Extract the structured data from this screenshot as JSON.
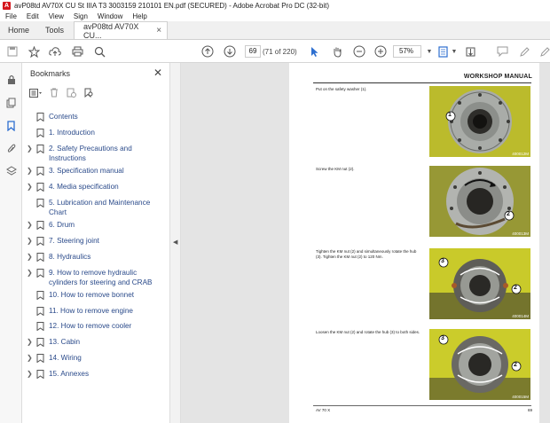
{
  "window": {
    "title": "avP08td AV70X CU St IIIA T3 3003159 210101 EN.pdf (SECURED) - Adobe Acrobat Pro DC (32-bit)"
  },
  "menu": [
    "File",
    "Edit",
    "View",
    "Sign",
    "Window",
    "Help"
  ],
  "tabs": {
    "home": "Home",
    "tools": "Tools",
    "document": "avP08td AV70X CU..."
  },
  "toolbar": {
    "page_number": "69",
    "page_count": "(71 of 220)",
    "zoom": "57%"
  },
  "bookmarks": {
    "title": "Bookmarks",
    "items": [
      {
        "label": "Contents",
        "expandable": false
      },
      {
        "label": "1. Introduction",
        "expandable": false
      },
      {
        "label": "2. Safety Precautions and Instructions",
        "expandable": true
      },
      {
        "label": "3. Specification manual",
        "expandable": true
      },
      {
        "label": "4. Media specification",
        "expandable": true
      },
      {
        "label": "5. Lubrication and Maintenance Chart",
        "expandable": false
      },
      {
        "label": "6. Drum",
        "expandable": true
      },
      {
        "label": "7. Steering joint",
        "expandable": true
      },
      {
        "label": "8. Hydraulics",
        "expandable": true
      },
      {
        "label": "9. How to remove hydraulic cylinders for steering and CRAB",
        "expandable": true
      },
      {
        "label": "10. How to remove bonnet",
        "expandable": false
      },
      {
        "label": "11. How to remove engine",
        "expandable": false
      },
      {
        "label": "12. How to remove cooler",
        "expandable": false
      },
      {
        "label": "13. Cabin",
        "expandable": true
      },
      {
        "label": "14. Wiring",
        "expandable": true
      },
      {
        "label": "15. Annexes",
        "expandable": true
      }
    ]
  },
  "page": {
    "header": "WORKSHOP MANUAL",
    "steps": [
      {
        "text": "Put on the safety washer (1).",
        "photo_code": "400012M",
        "markers": [
          "1"
        ]
      },
      {
        "text": "Screw the KM nut (2).",
        "photo_code": "400013M",
        "markers": [
          "2"
        ]
      },
      {
        "text": "Tighten the KM nut (2) and simultaneously rotate the hub (3). Tighten the KM nut (2) to 120 Nm.",
        "photo_code": "400014M",
        "markers": [
          "2",
          "3"
        ]
      },
      {
        "text": "Loosen the KM nut (2) and rotate the hub (3) to both sides.",
        "photo_code": "400015M",
        "markers": [
          "2",
          "3"
        ]
      }
    ],
    "footer_left": "AV 70 X",
    "footer_page": "69"
  },
  "colors": {
    "accent_red": "#d5161c",
    "bookmark_text": "#2a4a8a",
    "photo_yellow": "#d8d92a"
  }
}
